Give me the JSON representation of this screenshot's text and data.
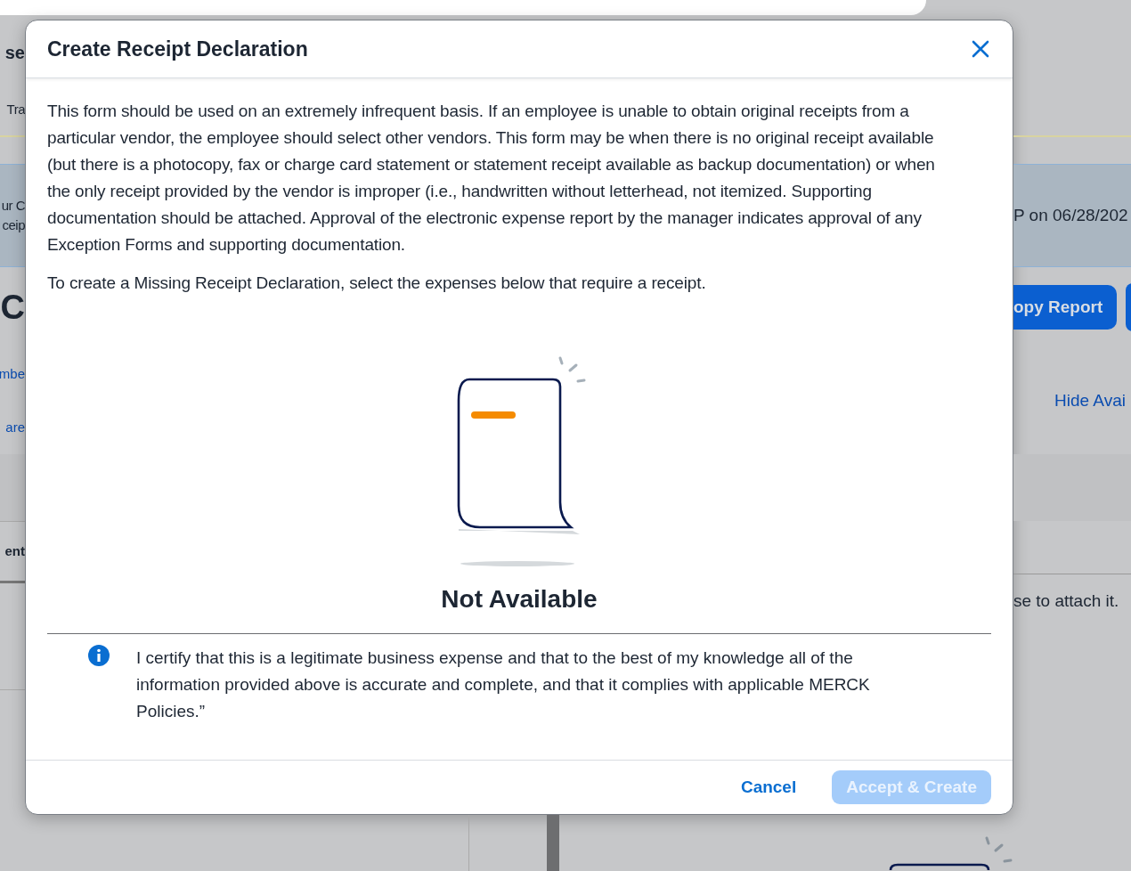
{
  "background": {
    "left": [
      {
        "kind": "heading",
        "text": "se"
      },
      {
        "kind": "text",
        "text": "Tra"
      },
      {
        "kind": "band",
        "lines": [
          "ur C",
          "ceip"
        ]
      },
      {
        "kind": "big",
        "text": "C"
      },
      {
        "kind": "link",
        "text": "mbe"
      },
      {
        "kind": "link",
        "text": "are"
      },
      {
        "kind": "bold",
        "text": "ent"
      }
    ],
    "right": [
      {
        "kind": "band",
        "lines": [
          "P on 06/28/202"
        ]
      },
      {
        "kind": "button",
        "text": "opy Report"
      },
      {
        "kind": "link",
        "text": "Hide Avai"
      },
      {
        "kind": "text",
        "text": "se to attach it."
      }
    ]
  },
  "dialog": {
    "title": "Create Receipt Declaration",
    "paragraphs": [
      "This form should be used on an extremely infrequent basis. If an employee is unable to obtain original receipts from a particular vendor, the employee should select other vendors. This form may be when there is no original receipt available (but there is a photocopy, fax or charge card statement or statement receipt available as backup documentation) or when the only receipt provided by the vendor is improper (i.e., handwritten without letterhead, not itemized. Supporting documentation should be attached. Approval of the electronic expense report by the manager indicates approval of any Exception Forms and supporting documentation.",
      "To create a Missing Receipt Declaration, select the expenses below that require a receipt."
    ],
    "empty_state": "Not Available",
    "certification": "I certify that this is a legitimate business expense and that to the best of my knowledge all of the information provided above is accurate and complete, and that it complies with applicable MERCK Policies.”",
    "buttons": [
      {
        "kind": "link",
        "label": "Cancel",
        "disabled": false
      },
      {
        "kind": "primary",
        "label": "Accept & Create",
        "disabled": true
      }
    ]
  }
}
